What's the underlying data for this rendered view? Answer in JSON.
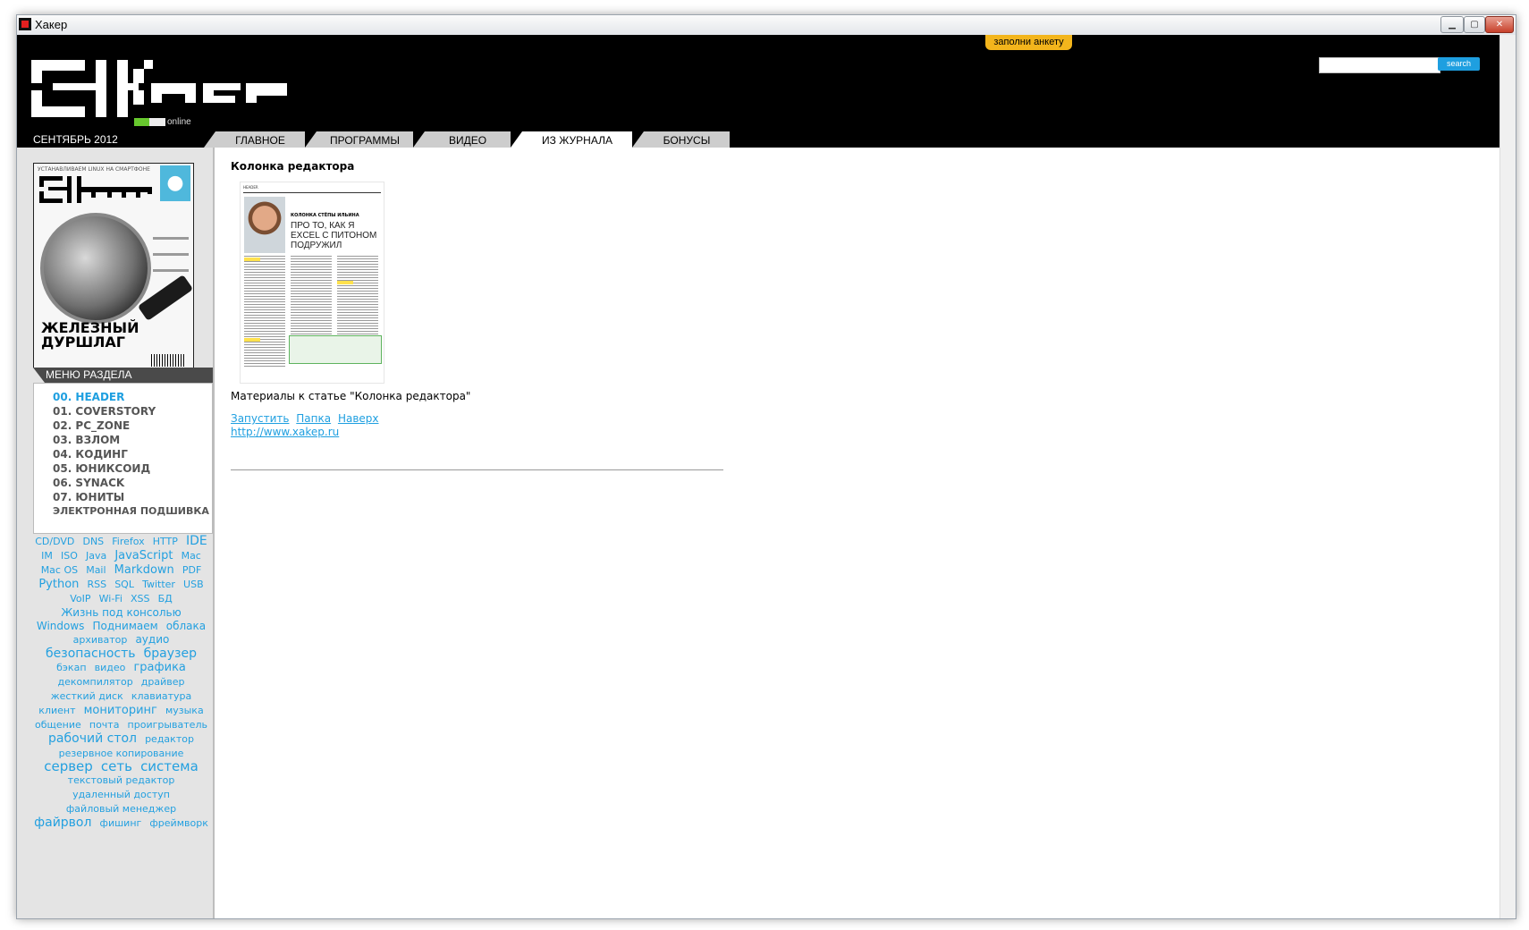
{
  "window": {
    "title": "Хакер",
    "buttons": {
      "minimize": "▁",
      "maximize": "▢",
      "close": "✕"
    }
  },
  "header": {
    "logo_alt": "ХАКЕР",
    "logo_online": "online",
    "issue_date": "СЕНТЯБРЬ 2012",
    "survey_label": "заполни анкету",
    "search": {
      "placeholder": "",
      "button_label": "search"
    },
    "tabs": [
      {
        "label": "ГЛАВНОЕ",
        "active": false
      },
      {
        "label": "ПРОГРАММЫ",
        "active": false
      },
      {
        "label": "ВИДЕО",
        "active": false
      },
      {
        "label": "ИЗ ЖУРНАЛА",
        "active": true
      },
      {
        "label": "БОНУСЫ",
        "active": false
      }
    ]
  },
  "sidebar": {
    "cover": {
      "topline": "УСТАНАВЛИВАЕМ LINUX НА СМАРТФОНЕ",
      "headline_1": "ЖЕЛЕЗНЫЙ",
      "headline_2": "ДУРШЛАГ"
    },
    "menu_title": "МЕНЮ РАЗДЕЛА",
    "menu_items": [
      {
        "label": "00. HEADER",
        "active": true
      },
      {
        "label": "01. COVERSTORY",
        "active": false
      },
      {
        "label": "02. PC_ZONE",
        "active": false
      },
      {
        "label": "03. ВЗЛОМ",
        "active": false
      },
      {
        "label": "04. КОДИНГ",
        "active": false
      },
      {
        "label": "05. ЮНИКСОИД",
        "active": false
      },
      {
        "label": "06. SYNACK",
        "active": false
      },
      {
        "label": "07. ЮНИТЫ",
        "active": false
      },
      {
        "label": "ЭЛЕКТРОННАЯ ПОДШИВКА",
        "active": false
      }
    ],
    "tags": [
      {
        "label": "CD/DVD",
        "size": 11
      },
      {
        "label": "DNS",
        "size": 11
      },
      {
        "label": "Firefox",
        "size": 11
      },
      {
        "label": "HTTP",
        "size": 11
      },
      {
        "label": "IDE",
        "size": 14
      },
      {
        "label": "IM",
        "size": 11
      },
      {
        "label": "ISO",
        "size": 11
      },
      {
        "label": "Java",
        "size": 11
      },
      {
        "label": "JavaScript",
        "size": 13
      },
      {
        "label": "Mac",
        "size": 11
      },
      {
        "label": "Mac OS",
        "size": 11
      },
      {
        "label": "Mail",
        "size": 11
      },
      {
        "label": "Markdown",
        "size": 13
      },
      {
        "label": "PDF",
        "size": 11
      },
      {
        "label": "Python",
        "size": 13
      },
      {
        "label": "RSS",
        "size": 11
      },
      {
        "label": "SQL",
        "size": 11
      },
      {
        "label": "Twitter",
        "size": 11
      },
      {
        "label": "USB",
        "size": 11
      },
      {
        "label": "VoIP",
        "size": 11
      },
      {
        "label": "Wi-Fi",
        "size": 11
      },
      {
        "label": "XSS",
        "size": 11
      },
      {
        "label": "БД",
        "size": 11
      },
      {
        "label": "Жизнь под консолью",
        "size": 12
      },
      {
        "label": "Windows",
        "size": 12
      },
      {
        "label": "Поднимаем",
        "size": 12
      },
      {
        "label": "облака",
        "size": 12
      },
      {
        "label": "архиватор",
        "size": 11
      },
      {
        "label": "аудио",
        "size": 12
      },
      {
        "label": "безопасность",
        "size": 14
      },
      {
        "label": "браузер",
        "size": 14
      },
      {
        "label": "бэкап",
        "size": 11
      },
      {
        "label": "видео",
        "size": 11
      },
      {
        "label": "графика",
        "size": 13
      },
      {
        "label": "декомпилятор",
        "size": 11
      },
      {
        "label": "драйвер",
        "size": 11
      },
      {
        "label": "жесткий диск",
        "size": 11
      },
      {
        "label": "клавиатура",
        "size": 11
      },
      {
        "label": "клиент",
        "size": 11
      },
      {
        "label": "мониторинг",
        "size": 13
      },
      {
        "label": "музыка",
        "size": 11
      },
      {
        "label": "общение",
        "size": 11
      },
      {
        "label": "почта",
        "size": 11
      },
      {
        "label": "проигрыватель",
        "size": 11
      },
      {
        "label": "рабочий стол",
        "size": 14
      },
      {
        "label": "редактор",
        "size": 11
      },
      {
        "label": "резервное копирование",
        "size": 11
      },
      {
        "label": "сервер",
        "size": 15
      },
      {
        "label": "сеть",
        "size": 15
      },
      {
        "label": "система",
        "size": 15
      },
      {
        "label": "текстовый редактор",
        "size": 11
      },
      {
        "label": "удаленный доступ",
        "size": 11
      },
      {
        "label": "файловый менеджер",
        "size": 11
      },
      {
        "label": "файрвол",
        "size": 14
      },
      {
        "label": "фишинг",
        "size": 11
      },
      {
        "label": "фреймворк",
        "size": 11
      }
    ]
  },
  "main": {
    "title": "Колонка редактора",
    "thumbnail": {
      "section": "HEADER",
      "author": "КОЛОНКА СТЁПЫ ИЛЬИНА",
      "headline": "ПРО ТО, КАК Я EXCEL С ПИТОНОМ ПОДРУЖИЛ"
    },
    "materials_text": "Материалы к статье \"Колонка редактора\"",
    "links": [
      "Запустить",
      "Папка",
      "Наверх"
    ],
    "url": "http://www.xakep.ru"
  },
  "colors": {
    "accent": "#1e9fe0",
    "header_bg": "#000000",
    "sidebar_bg": "#e4e4e4",
    "survey": "#f3b51c",
    "online_green": "#67c82e"
  }
}
